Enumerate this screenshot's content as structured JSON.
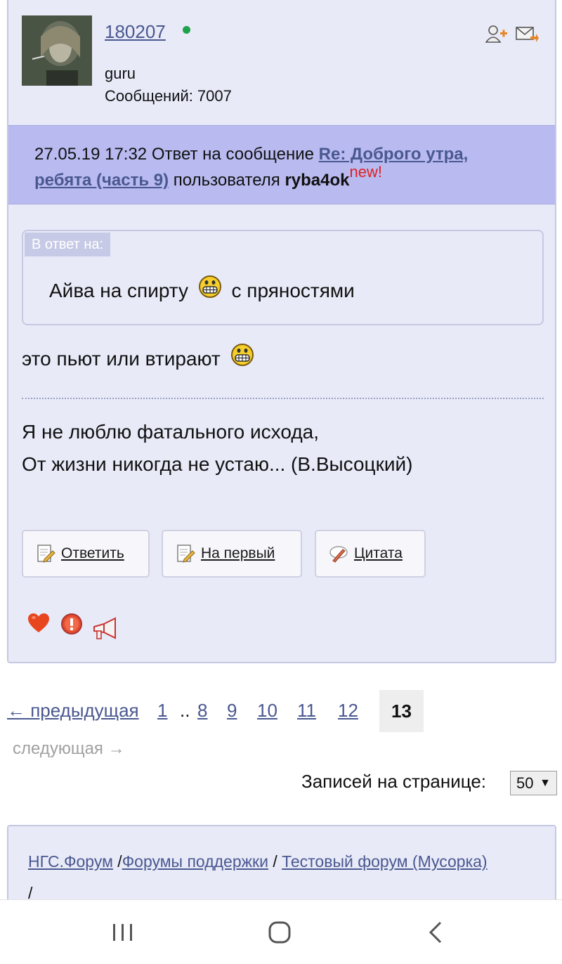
{
  "post": {
    "username": "180207",
    "rank": "guru",
    "messages_label": "Сообщений:",
    "messages_count": "7007",
    "online": true
  },
  "reply_header": {
    "datetime": "27.05.19 17:32",
    "prefix": "Ответ на сообщение",
    "thread_title": "Re: Доброго утра, ребята (часть 9)",
    "user_prefix": "пользователя",
    "author": "ryba4ok",
    "new_tag": "new!"
  },
  "quote": {
    "label": "В ответ на:",
    "text_before": "Айва на спирту",
    "text_after": "с пряностями"
  },
  "body": {
    "text": "это пьют или втирают"
  },
  "signature": {
    "line1": "Я не люблю фатального исхода,",
    "line2": "От жизни никогда не устаю... (В.Высоцкий)"
  },
  "actions": {
    "reply": "Ответить",
    "to_first": "На первый",
    "quote": "Цитата"
  },
  "pagination": {
    "prev": "← предыдущая",
    "pages": [
      "1",
      "8",
      "9",
      "10",
      "11",
      "12"
    ],
    "dots": "..",
    "current": "13",
    "next": "следующая →"
  },
  "per_page": {
    "label": "Записей на странице:",
    "value": "50",
    "arrow": "▼"
  },
  "breadcrumbs": {
    "items": [
      "НГС.Форум",
      "Форумы поддержки",
      "Тестовый форум (Мусорка)"
    ],
    "separator": "/"
  },
  "colors": {
    "card_bg": "#e8eaf8",
    "reply_bar": "#b8baf0",
    "link": "#4a5890",
    "new_tag": "#e02020",
    "online": "#1fa34a"
  },
  "icons": [
    "add-user-icon",
    "mail-icon",
    "smile-icon",
    "edit-icon",
    "quote-icon",
    "heart-icon",
    "warning-icon",
    "megaphone-icon",
    "recent-apps-icon",
    "home-icon",
    "back-icon"
  ]
}
